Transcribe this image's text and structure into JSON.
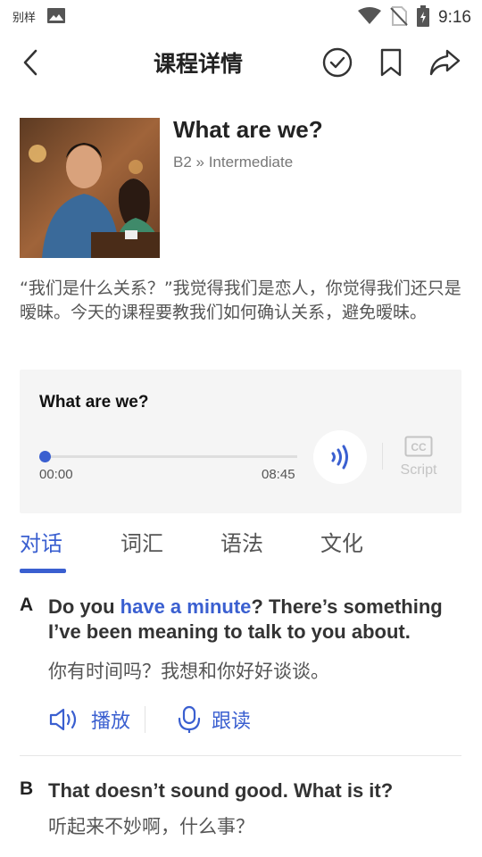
{
  "status_bar": {
    "carrier": "别样",
    "time": "9:16"
  },
  "nav": {
    "title": "课程详情"
  },
  "course": {
    "title": "What are we?",
    "level": "B2 » Intermediate",
    "description": "“我们是什么关系？”我觉得我们是恋人，你觉得我们还只是暧昧。今天的课程要教我们如何确认关系，避免暧昧。"
  },
  "player": {
    "title": "What are we?",
    "current_time": "00:00",
    "duration": "08:45",
    "progress": 0.0,
    "cc_label": "Script"
  },
  "tabs": [
    {
      "label": "对话",
      "active": true
    },
    {
      "label": "词汇",
      "active": false
    },
    {
      "label": "语法",
      "active": false
    },
    {
      "label": "文化",
      "active": false
    }
  ],
  "dialogue": [
    {
      "speaker": "A",
      "en_before": "Do you ",
      "en_highlight": "have a minute",
      "en_after": "? There’s something I’ve been meaning to talk to you about.",
      "zh": "你有时间吗？我想和你好好谈谈。",
      "play_label": "播放",
      "follow_label": "跟读"
    },
    {
      "speaker": "B",
      "en_before": "That doesn’t sound good. What is it?",
      "en_highlight": "",
      "en_after": "",
      "zh": "听起来不妙啊，什么事？"
    }
  ],
  "colors": {
    "accent": "#3a5fd0",
    "player_bg": "#f5f5f5"
  },
  "icons": [
    "image-icon",
    "wifi-icon",
    "no-sim-icon",
    "battery-icon",
    "back-icon",
    "check-circle-icon",
    "bookmark-icon",
    "share-icon",
    "sound-wave-icon",
    "cc-icon",
    "speaker-icon",
    "microphone-icon"
  ]
}
